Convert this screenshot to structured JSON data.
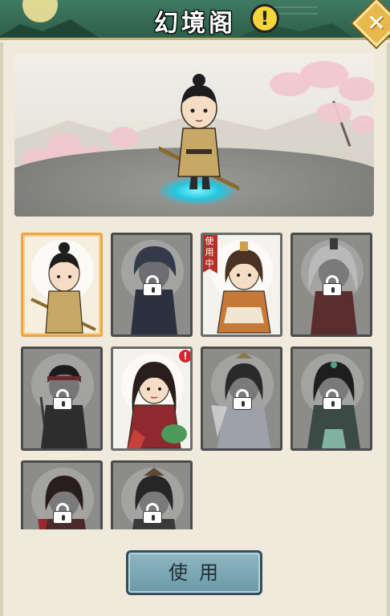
{
  "header": {
    "title": "幻境阁",
    "info_icon": "exclamation-icon",
    "info_symbol": "!",
    "close_icon": "close-icon",
    "close_symbol": "✕"
  },
  "preview": {
    "character": "hero-staff-wielder",
    "scene": "cherry-blossom-stone-platform"
  },
  "skins": [
    {
      "id": "skin-1",
      "locked": false,
      "selected": true,
      "in_use": false,
      "alert": false
    },
    {
      "id": "skin-2",
      "locked": true,
      "selected": false,
      "in_use": false,
      "alert": false
    },
    {
      "id": "skin-3",
      "locked": false,
      "selected": false,
      "in_use": true,
      "alert": false,
      "tag": "使用中"
    },
    {
      "id": "skin-4",
      "locked": true,
      "selected": false,
      "in_use": false,
      "alert": false
    },
    {
      "id": "skin-5",
      "locked": true,
      "selected": false,
      "in_use": false,
      "alert": false
    },
    {
      "id": "skin-6",
      "locked": false,
      "selected": false,
      "in_use": false,
      "alert": true,
      "alert_symbol": "!"
    },
    {
      "id": "skin-7",
      "locked": true,
      "selected": false,
      "in_use": false,
      "alert": false
    },
    {
      "id": "skin-8",
      "locked": true,
      "selected": false,
      "in_use": false,
      "alert": false
    },
    {
      "id": "skin-9",
      "locked": true,
      "selected": false,
      "in_use": false,
      "alert": false
    },
    {
      "id": "skin-10",
      "locked": true,
      "selected": false,
      "in_use": false,
      "alert": false
    }
  ],
  "actions": {
    "use_label": "使用"
  },
  "colors": {
    "header_green": "#2e5f4b",
    "selected_border": "#e9a64a",
    "button_blue": "#6c98a6",
    "alert_red": "#d9232d"
  }
}
